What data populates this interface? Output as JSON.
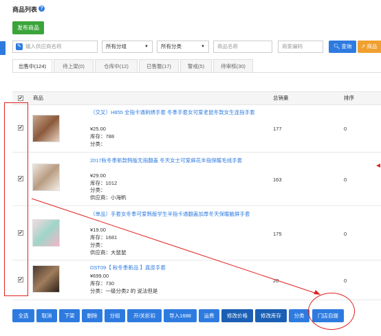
{
  "header": {
    "title": "商品列表",
    "help_icon": "question-circle-icon"
  },
  "toolbar": {
    "publish_label": "发布商品",
    "supplier_placeholder": "输入供应商名称",
    "group_select": "所有分组",
    "category_select": "所有分类",
    "name_placeholder": "商品名称",
    "code_placeholder": "商家编码",
    "query_label": "查询",
    "goods_label": "商品"
  },
  "tabs": [
    {
      "label": "出售中(124)"
    },
    {
      "label": "待上架(0)"
    },
    {
      "label": "仓库中(12)"
    },
    {
      "label": "已售罄(17)"
    },
    {
      "label": "警戒(5)"
    },
    {
      "label": "待审核(30)"
    }
  ],
  "table": {
    "headers": {
      "product": "商品",
      "sales": "总销量",
      "sort": "排序"
    },
    "rows": [
      {
        "checked": "✔",
        "name": "（交叉）H855 全指卡通刺绣手套 冬季手套女可爱老鼠冬款女生连指手套",
        "price": "¥25.00",
        "stock": "库存：788",
        "category": "分类：",
        "supplier": "",
        "sales": "177",
        "sort": "0"
      },
      {
        "checked": "✔",
        "name": "2017秋冬季新款韩版无指翻盖 冬天女士可爱麻花半指保暖毛线手套",
        "price": "¥29.00",
        "stock": "库存：1012",
        "category": "分类：",
        "supplier": "供应商：小海帆",
        "sales": "163",
        "sort": "0"
      },
      {
        "checked": "✔",
        "name": "（单品）手套女冬季可爱韩版学生半指卡通翻盖加厚冬天保暖触屏手套",
        "price": "¥19.00",
        "stock": "库存：1681",
        "category": "分类：",
        "supplier": "供应商：大鼠鼠",
        "sales": "175",
        "sort": "0"
      },
      {
        "checked": "✔",
        "name": "DST09【 秋冬季新品 】真皮手套",
        "price": "¥699.00",
        "stock": "库存：730",
        "category": "分类：一级分类2 的 说法但是",
        "supplier": "",
        "sales": "20",
        "sort": "0"
      }
    ]
  },
  "bottom_buttons": [
    {
      "label": "全选"
    },
    {
      "label": "取消"
    },
    {
      "label": "下架"
    },
    {
      "label": "删除"
    },
    {
      "label": "分组"
    },
    {
      "label": "开/关折扣"
    },
    {
      "label": "导入1688"
    },
    {
      "label": "运费"
    },
    {
      "label": "修改价格"
    },
    {
      "label": "修改库存"
    },
    {
      "label": "分类"
    },
    {
      "label": "门店自提"
    }
  ],
  "colors": {
    "accent": "#2e7be0",
    "publish": "#3aa43a",
    "annotation": "#e02020"
  }
}
